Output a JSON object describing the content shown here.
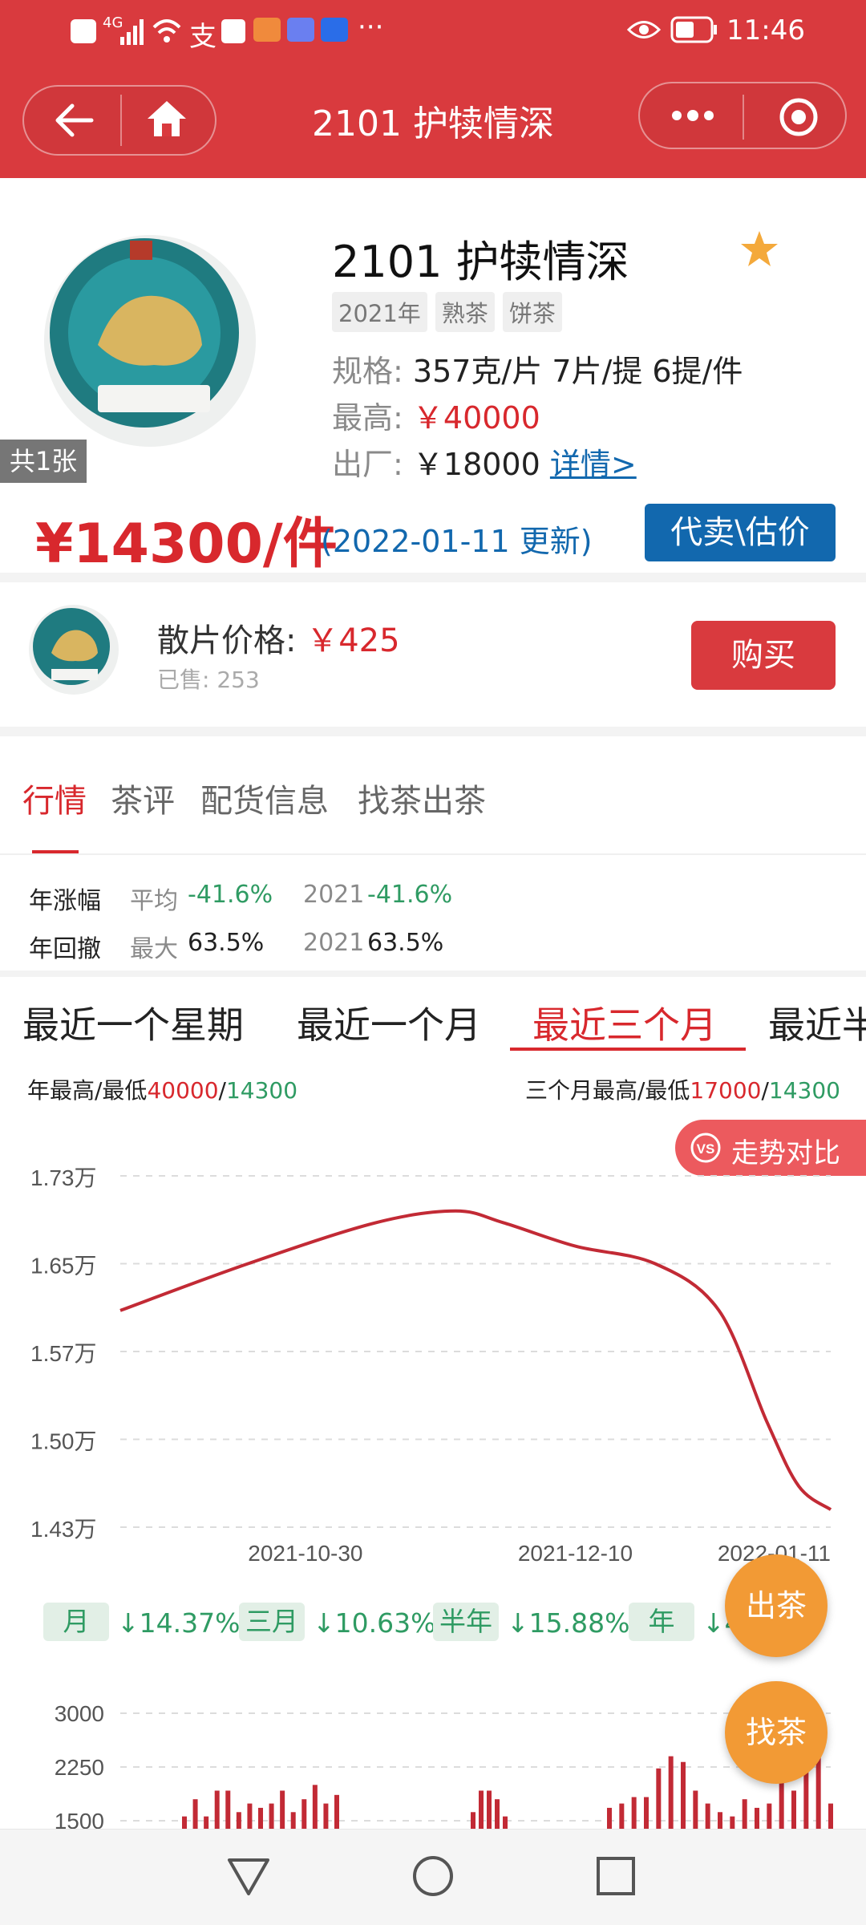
{
  "status_bar": {
    "time": "11:46",
    "network": "4G"
  },
  "nav": {
    "title": "2101 护犊情深"
  },
  "product": {
    "name": "2101 护犊情深",
    "photo_count": "共1张",
    "tags": [
      "2021年",
      "熟茶",
      "饼茶"
    ],
    "spec_label": "规格:",
    "spec_value": "357克/片 7片/提 6提/件",
    "max_label": "最高:",
    "max_value": "￥40000",
    "factory_label": "出厂:",
    "factory_value": "￥18000",
    "detail_link": "详情>",
    "price": "¥14300/件",
    "update_note": "(2022-01-11 更新)",
    "consign_button": "代卖\\估价"
  },
  "loose": {
    "label": "散片价格:",
    "price": "￥425",
    "sold": "已售: 253",
    "buy_button": "购买"
  },
  "tabs": {
    "t1": "行情",
    "t2": "茶评",
    "t3": "配货信息",
    "t4": "找茶出茶"
  },
  "stats": {
    "row1_label": "年涨幅",
    "row1_a_label": "平均",
    "row1_a_value": "-41.6%",
    "row1_b_label": "2021",
    "row1_b_value": "-41.6%",
    "row2_label": "年回撤",
    "row2_a_label": "最大",
    "row2_a_value": "63.5%",
    "row2_b_label": "2021",
    "row2_b_value": "63.5%"
  },
  "ranges": {
    "r1": "最近一个星期",
    "r2": "最近一个月",
    "r3": "最近三个月",
    "r4": "最近半"
  },
  "highlow": {
    "year_label": "年最高/最低",
    "year_high": "40000",
    "year_low": "14300",
    "three_label": "三个月最高/最低",
    "three_high": "17000",
    "three_low": "14300",
    "sep": "/"
  },
  "compare_button": "走势对比",
  "changes": {
    "m_label": "月",
    "m_value": "↓14.37%",
    "q_label": "三月",
    "q_value": "↓10.63%",
    "h_label": "半年",
    "h_value": "↓15.88%",
    "y_label": "年",
    "y_value": "↓42.8%"
  },
  "fab": {
    "sell": "出茶",
    "find": "找茶"
  },
  "colors": {
    "brand_red": "#d93a3e",
    "price_red": "#d8282d",
    "down_green": "#2f9b63",
    "blue": "#1268ae",
    "orange": "#f29a35"
  },
  "chart_data": [
    {
      "type": "line",
      "x_tick_labels": [
        "2021-10-30",
        "2021-12-10",
        "2022-01-11"
      ],
      "y_tick_labels": [
        "1.73万",
        "1.65万",
        "1.57万",
        "1.50万",
        "1.43万"
      ],
      "ylim": [
        14300,
        17300
      ],
      "xlim": [
        "2021-10-14",
        "2022-01-11"
      ],
      "grid": true,
      "x": [
        "2021-10-14",
        "2021-10-30",
        "2021-11-15",
        "2021-11-25",
        "2021-12-01",
        "2021-12-10",
        "2021-12-20",
        "2021-12-28",
        "2022-01-03",
        "2022-01-07",
        "2022-01-11"
      ],
      "y": [
        16150,
        16550,
        16900,
        17000,
        16900,
        16700,
        16550,
        16150,
        15200,
        14650,
        14450
      ],
      "color": "#c22a35"
    },
    {
      "type": "bar",
      "y_tick_labels": [
        "3000",
        "2250",
        "1500"
      ],
      "ylim": [
        1500,
        3000
      ],
      "grid": true,
      "values": [
        1560,
        1800,
        1560,
        1920,
        1920,
        1620,
        1740,
        1680,
        1740,
        1920,
        1620,
        1800,
        2000,
        1740,
        1860,
        1620,
        1920,
        1920,
        1800,
        1560,
        1680,
        1740,
        1830,
        1830,
        2230,
        2400,
        2320,
        1920,
        1740,
        1620,
        1560,
        1800,
        1680,
        1740,
        2100,
        1920,
        2230,
        2620,
        1740
      ],
      "color": "#c22a35"
    }
  ]
}
